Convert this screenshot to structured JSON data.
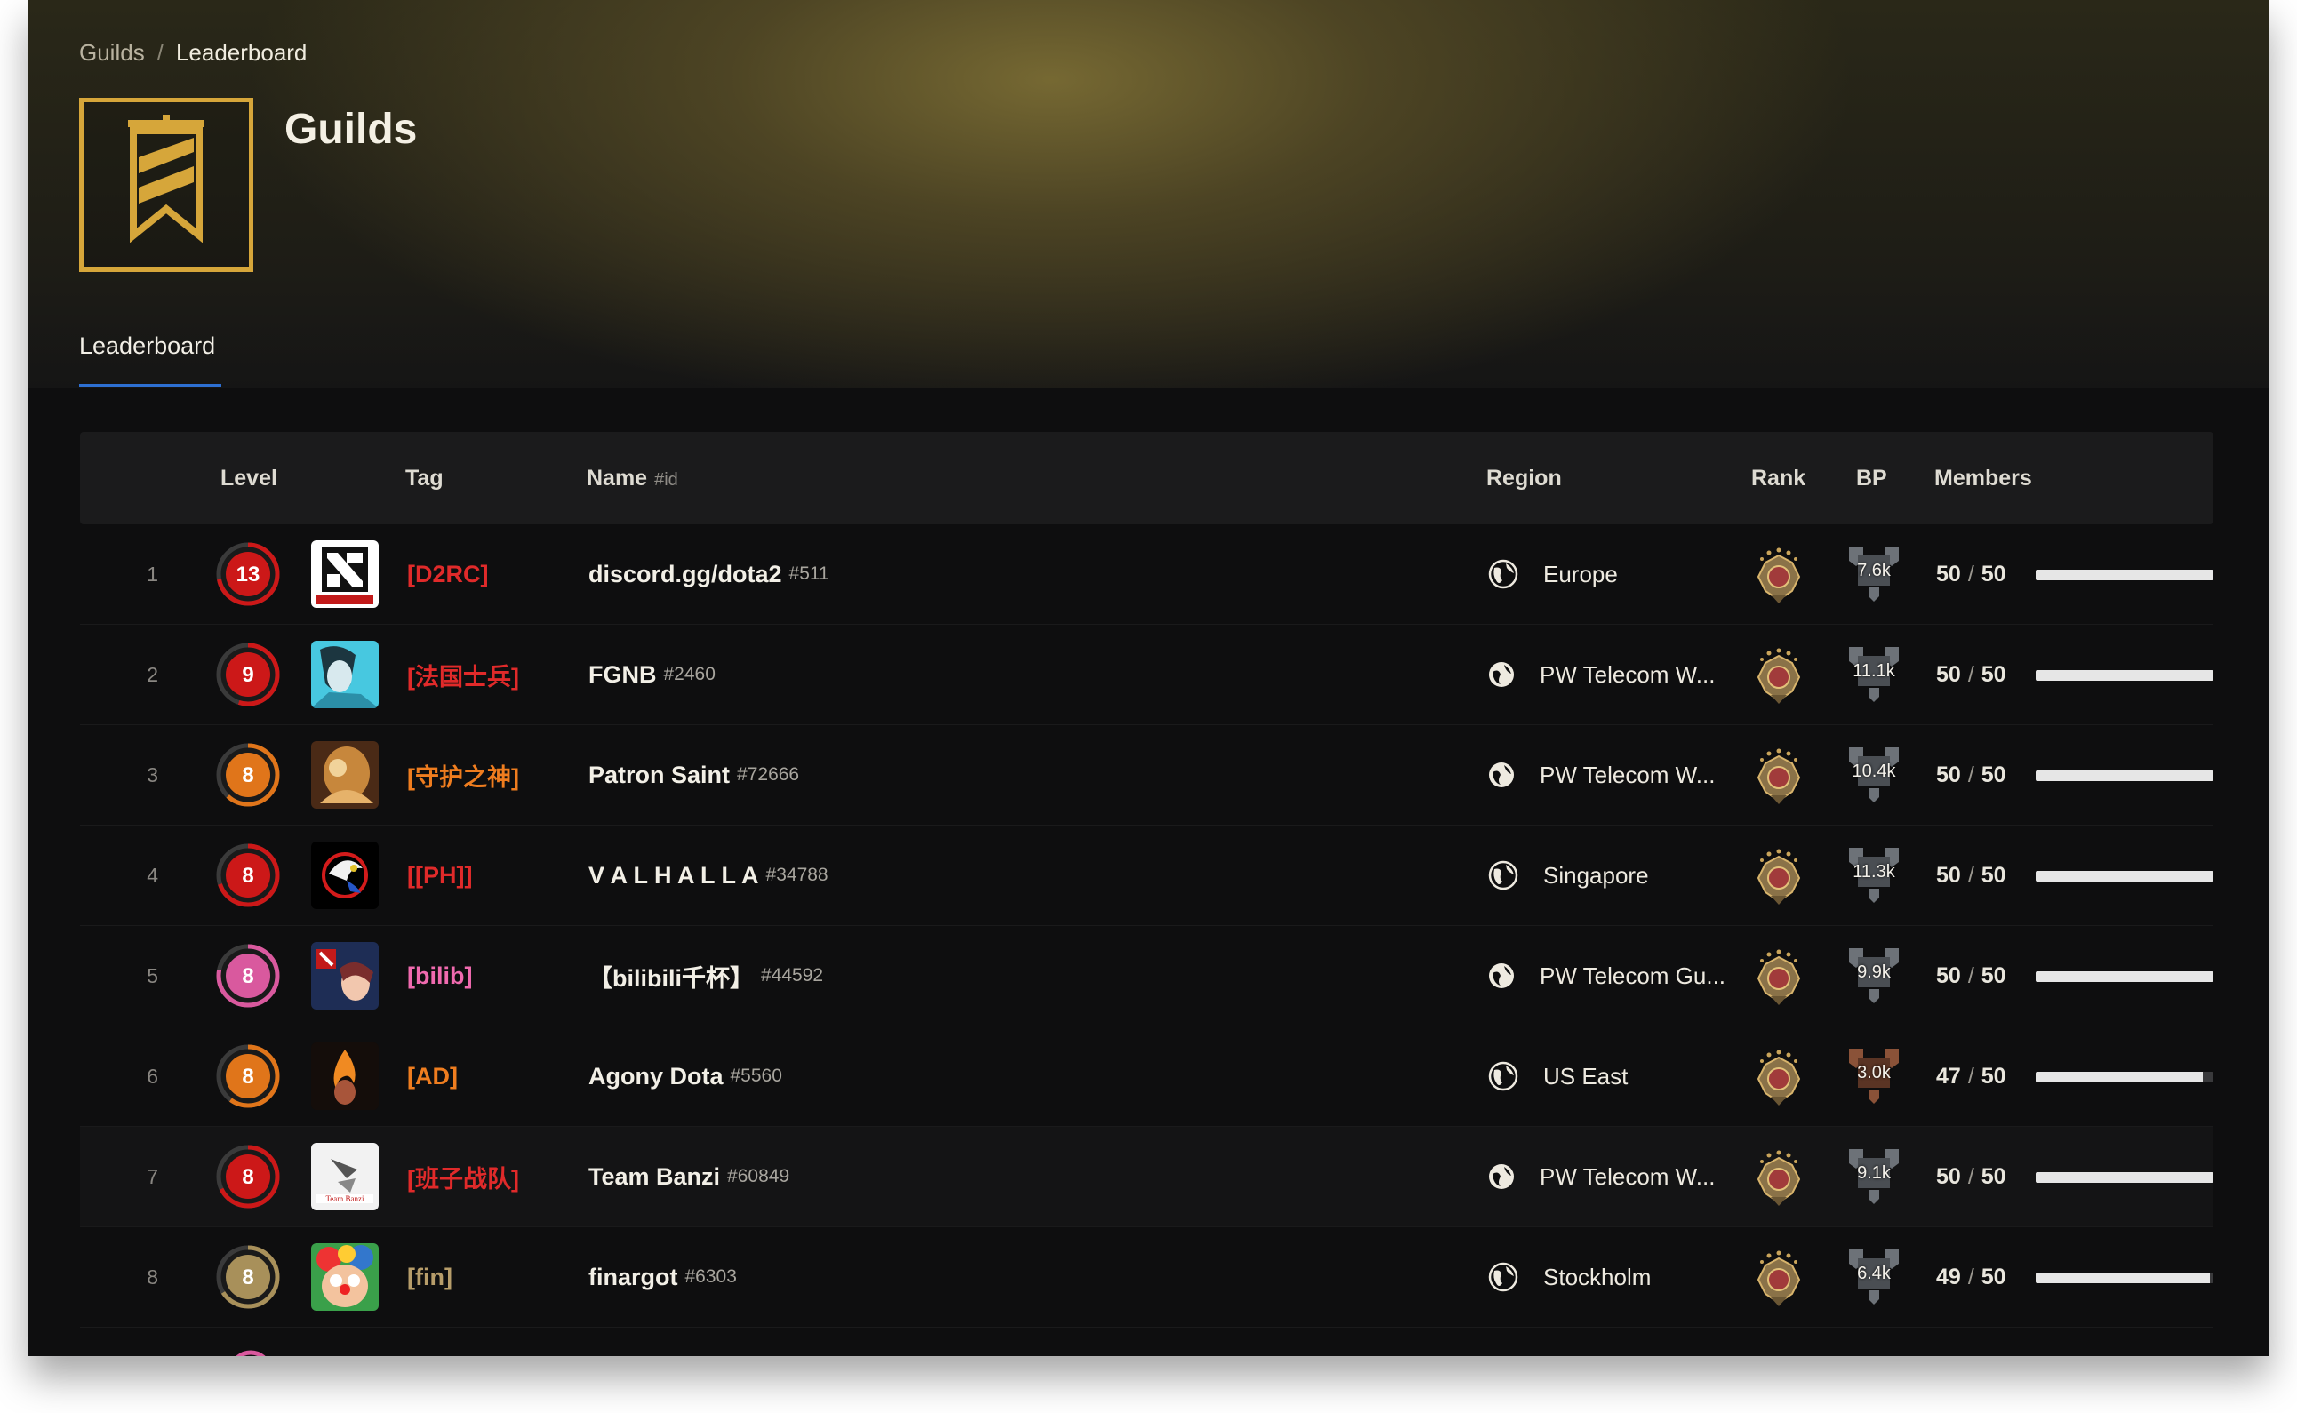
{
  "breadcrumb": {
    "parent": "Guilds",
    "separator": "/",
    "current": "Leaderboard"
  },
  "page": {
    "title": "Guilds"
  },
  "tabs": [
    {
      "label": "Leaderboard",
      "active": true
    }
  ],
  "table": {
    "headers": {
      "level": "Level",
      "tag": "Tag",
      "name": "Name",
      "name_suffix": "#id",
      "region": "Region",
      "rank": "Rank",
      "bp": "BP",
      "members": "Members"
    },
    "rows": [
      {
        "pos": "1",
        "level": "13",
        "level_color": "#cc1818",
        "level_progress": 0.72,
        "avatar": "dota-logo-avatar",
        "tag": "[D2RC]",
        "tag_color": "#e02a2a",
        "name": "discord.gg/dota2",
        "id": "#511",
        "region": "Europe",
        "region_icon": "globe-icon",
        "bp": "7.6k",
        "bp_tier": "silver",
        "members": "50",
        "capacity": "50",
        "fill": 1.0
      },
      {
        "pos": "2",
        "level": "9",
        "level_color": "#cc1818",
        "level_progress": 0.55,
        "avatar": "hero-face-avatar",
        "tag": "[法国士兵]",
        "tag_color": "#e02a2a",
        "name": "FGNB",
        "id": "#2460",
        "region": "PW Telecom W...",
        "region_icon": "region-icon",
        "bp": "11.1k",
        "bp_tier": "silver",
        "members": "50",
        "capacity": "50",
        "fill": 1.0
      },
      {
        "pos": "3",
        "level": "8",
        "level_color": "#e0751a",
        "level_progress": 0.62,
        "avatar": "golden-hero-avatar",
        "tag": "[守护之神]",
        "tag_color": "#ef7d1f",
        "name": "Patron Saint",
        "id": "#72666",
        "region": "PW Telecom W...",
        "region_icon": "region-icon",
        "bp": "10.4k",
        "bp_tier": "silver",
        "members": "50",
        "capacity": "50",
        "fill": 1.0
      },
      {
        "pos": "4",
        "level": "8",
        "level_color": "#cc1818",
        "level_progress": 0.7,
        "avatar": "dragon-emblem-avatar",
        "tag": "[[PH]]",
        "tag_color": "#e02a2a",
        "name": "V A L H A L L A",
        "id": "#34788",
        "region": "Singapore",
        "region_icon": "globe-icon",
        "bp": "11.3k",
        "bp_tier": "silver",
        "members": "50",
        "capacity": "50",
        "fill": 1.0
      },
      {
        "pos": "5",
        "level": "8",
        "level_color": "#d9599e",
        "level_progress": 0.78,
        "avatar": "anime-dota-avatar",
        "tag": "[bilib]",
        "tag_color": "#f06aaf",
        "name": "【bilibili千杯】",
        "id": "#44592",
        "region": "PW Telecom Gu...",
        "region_icon": "region-icon",
        "bp": "9.9k",
        "bp_tier": "silver",
        "members": "50",
        "capacity": "50",
        "fill": 1.0
      },
      {
        "pos": "6",
        "level": "8",
        "level_color": "#e0751a",
        "level_progress": 0.6,
        "avatar": "flame-avatar",
        "tag": "[AD]",
        "tag_color": "#ef7d1f",
        "name": "Agony Dota",
        "id": "#5560",
        "region": "US East",
        "region_icon": "globe-icon",
        "bp": "3.0k",
        "bp_tier": "bronze",
        "members": "47",
        "capacity": "50",
        "fill": 0.94
      },
      {
        "pos": "7",
        "level": "8",
        "level_color": "#cc1818",
        "level_progress": 0.68,
        "avatar": "team-banzi-avatar",
        "tag": "[班子战队]",
        "tag_color": "#e02a2a",
        "name": "Team Banzi",
        "id": "#60849",
        "region": "PW Telecom W...",
        "region_icon": "region-icon",
        "bp": "9.1k",
        "bp_tier": "silver",
        "members": "50",
        "capacity": "50",
        "fill": 1.0
      },
      {
        "pos": "8",
        "level": "8",
        "level_color": "#a8905a",
        "level_progress": 0.66,
        "avatar": "clown-avatar",
        "tag": "[fin]",
        "tag_color": "#b79d6a",
        "name": "finargot",
        "id": "#6303",
        "region": "Stockholm",
        "region_icon": "globe-icon",
        "bp": "6.4k",
        "bp_tier": "silver",
        "members": "49",
        "capacity": "50",
        "fill": 0.98
      }
    ]
  },
  "colors": {
    "accent": "#2d6fd2",
    "logo_gold": "#d6a63a"
  }
}
